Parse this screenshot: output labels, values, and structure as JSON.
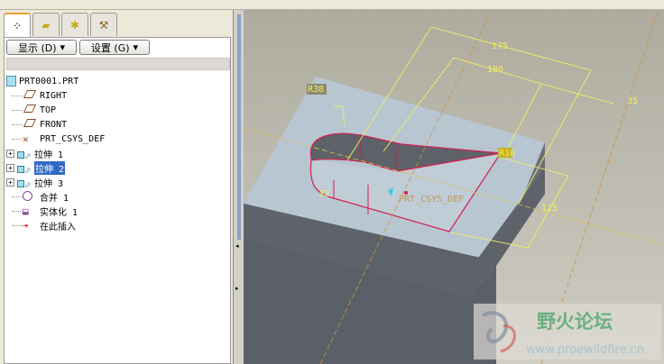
{
  "tabs": [
    "model-tree",
    "layers",
    "favorites",
    "tools"
  ],
  "toolbar": {
    "show_label": "显示 (D)",
    "settings_label": "设置 (G)"
  },
  "tree": {
    "root": "PRT0001.PRT",
    "items": [
      {
        "label": "RIGHT",
        "icon": "datum-plane-icon",
        "expandable": false
      },
      {
        "label": "TOP",
        "icon": "datum-plane-icon",
        "expandable": false
      },
      {
        "label": "FRONT",
        "icon": "datum-plane-icon",
        "expandable": false
      },
      {
        "label": "PRT_CSYS_DEF",
        "icon": "csys-icon",
        "expandable": false
      },
      {
        "label": "拉伸 1",
        "icon": "extrude-icon",
        "expandable": true
      },
      {
        "label": "拉伸 2",
        "icon": "extrude-icon",
        "expandable": true,
        "selected": true
      },
      {
        "label": "拉伸 3",
        "icon": "extrude-icon",
        "expandable": true
      },
      {
        "label": "合并 1",
        "icon": "merge-icon",
        "expandable": false
      },
      {
        "label": "实体化 1",
        "icon": "solidify-icon",
        "expandable": false
      },
      {
        "label": "在此插入",
        "icon": "insert-here-icon",
        "expandable": false
      }
    ]
  },
  "viewport": {
    "dims": {
      "d175": "175",
      "d100": "100",
      "d35": "35",
      "r38": "R38",
      "d32": "32",
      "d125": "125",
      "r10": "R10"
    },
    "csys_label": "PRT_CSYS_DEF",
    "watermark": {
      "title": "野火论坛",
      "url": "www.proewildfire.cn"
    }
  },
  "colors": {
    "dim": "#f0f060",
    "edge": "#d02050",
    "bg": "#b9b6aa",
    "top": "#b8c6d2"
  }
}
